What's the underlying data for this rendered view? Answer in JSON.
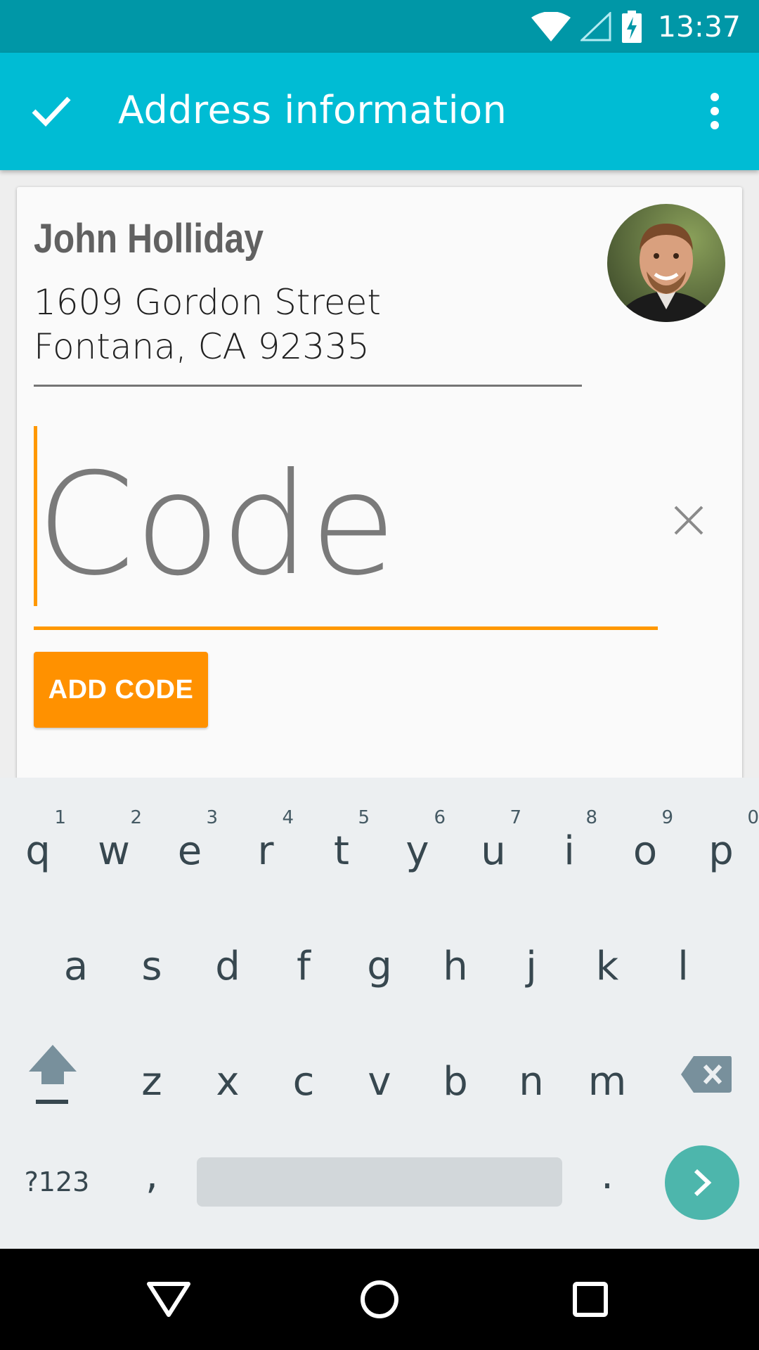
{
  "status_bar": {
    "time": "13:37"
  },
  "app_bar": {
    "title": "Address information"
  },
  "contact": {
    "name": "John Holliday",
    "address_line1": "1609 Gordon Street",
    "address_line2": "Fontana, CA 92335"
  },
  "code_field": {
    "placeholder": "Code",
    "value": ""
  },
  "add_code_button": {
    "label": "ADD CODE"
  },
  "keyboard": {
    "row1": [
      {
        "key": "q",
        "hint": "1"
      },
      {
        "key": "w",
        "hint": "2"
      },
      {
        "key": "e",
        "hint": "3"
      },
      {
        "key": "r",
        "hint": "4"
      },
      {
        "key": "t",
        "hint": "5"
      },
      {
        "key": "y",
        "hint": "6"
      },
      {
        "key": "u",
        "hint": "7"
      },
      {
        "key": "i",
        "hint": "8"
      },
      {
        "key": "o",
        "hint": "9"
      },
      {
        "key": "p",
        "hint": "0"
      }
    ],
    "row2": [
      "a",
      "s",
      "d",
      "f",
      "g",
      "h",
      "j",
      "k",
      "l"
    ],
    "row3": [
      "z",
      "x",
      "c",
      "v",
      "b",
      "n",
      "m"
    ],
    "symbols_key": "?123",
    "comma_key": ",",
    "period_key": "."
  },
  "colors": {
    "status_bar": "#0097a7",
    "app_bar": "#00bcd4",
    "accent": "#ff9800",
    "enter_key": "#4db6ac"
  }
}
